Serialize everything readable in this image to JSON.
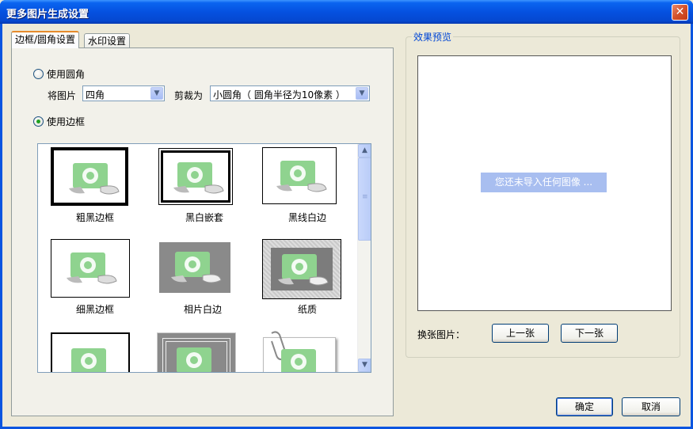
{
  "window": {
    "title": "更多图片生成设置",
    "close_symbol": "✕"
  },
  "tabs": [
    {
      "label": "边框/圆角设置",
      "active": true
    },
    {
      "label": "水印设置",
      "active": false
    }
  ],
  "round_corner": {
    "radio_label": "使用圆角",
    "checked": false,
    "image_label": "将图片",
    "corner_select": "四角",
    "crop_label": "剪裁为",
    "crop_select": "小圆角（ 圆角半径为10像素 ）"
  },
  "border": {
    "radio_label": "使用边框",
    "checked": true,
    "items": [
      {
        "label": "粗黑边框"
      },
      {
        "label": "黑白嵌套"
      },
      {
        "label": "黑线白边"
      },
      {
        "label": "细黑边框"
      },
      {
        "label": "相片白边"
      },
      {
        "label": "纸质"
      },
      {
        "label": ""
      },
      {
        "label": ""
      },
      {
        "label": ""
      }
    ]
  },
  "preview": {
    "group_title": "效果预览",
    "empty_message": "您还未导入任何图像 ...",
    "switch_label": "换张图片：",
    "prev_button": "上一张",
    "next_button": "下一张"
  },
  "footer": {
    "ok_button": "确定",
    "cancel_button": "取消"
  },
  "colors": {
    "title_bar": "#0551e0",
    "accent_tab": "#e68b2c",
    "preview_msg_bg": "#a8bef0",
    "ipod_green": "#8fd38f"
  }
}
